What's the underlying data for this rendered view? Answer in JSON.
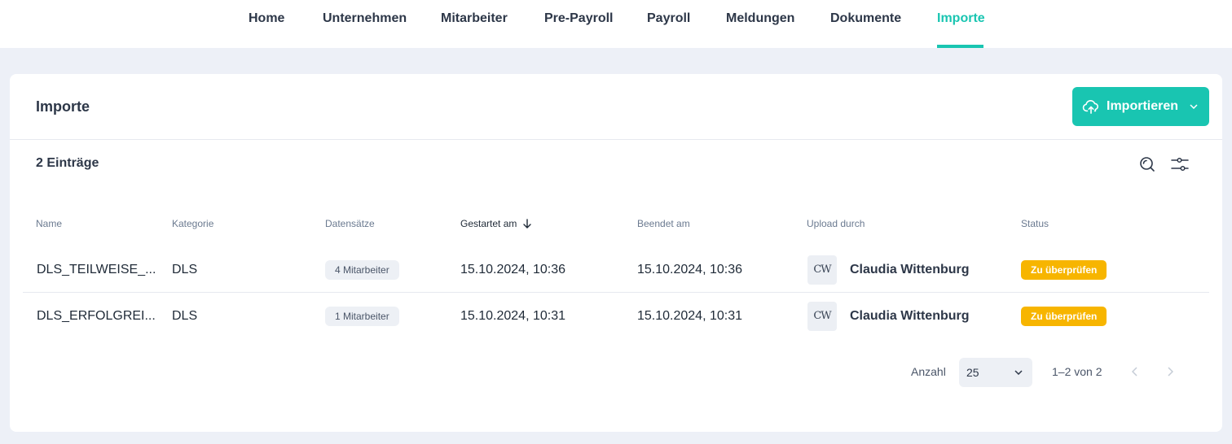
{
  "nav": {
    "items": [
      {
        "label": "Home"
      },
      {
        "label": "Unternehmen"
      },
      {
        "label": "Mitarbeiter"
      },
      {
        "label": "Pre-Payroll"
      },
      {
        "label": "Payroll"
      },
      {
        "label": "Meldungen"
      },
      {
        "label": "Dokumente"
      },
      {
        "label": "Importe"
      }
    ],
    "active": "Importe"
  },
  "header": {
    "title": "Importe",
    "import_button_label": "Importieren"
  },
  "list": {
    "count_label": "2 Einträge",
    "icons": [
      "search-icon",
      "filter-sliders-icon"
    ]
  },
  "table": {
    "columns": [
      "Name",
      "Kategorie",
      "Datensätze",
      "Gestartet am",
      "Beendet am",
      "Upload durch",
      "Status"
    ],
    "sorted_column": "Gestartet am",
    "rows": [
      {
        "name": "DLS_TEILWEISE_...",
        "kategorie": "DLS",
        "datensaetze": "4 Mitarbeiter",
        "gestartet": "15.10.2024, 10:36",
        "beendet": "15.10.2024, 10:36",
        "avatar": "CW",
        "upload": "Claudia Wittenburg",
        "status": "Zu überprüfen"
      },
      {
        "name": "DLS_ERFOLGREI...",
        "kategorie": "DLS",
        "datensaetze": "1 Mitarbeiter",
        "gestartet": "15.10.2024, 10:31",
        "beendet": "15.10.2024, 10:31",
        "avatar": "CW",
        "upload": "Claudia Wittenburg",
        "status": "Zu überprüfen"
      }
    ]
  },
  "pagination": {
    "label": "Anzahl",
    "page_size": "25",
    "range": "1–2 von 2"
  },
  "colors": {
    "accent": "#19c5b1",
    "status_warning": "#f7b500",
    "background": "#edf0f7"
  }
}
